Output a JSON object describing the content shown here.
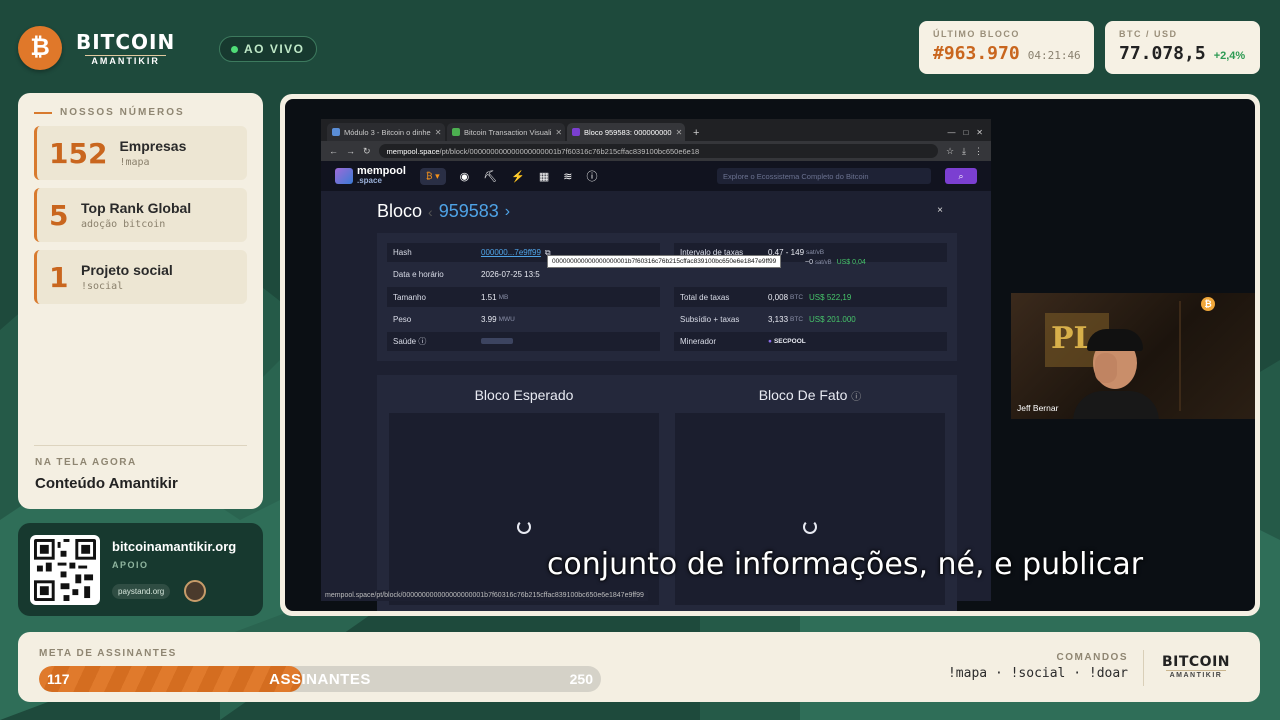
{
  "header": {
    "brand_title": "BITCOIN",
    "brand_sub": "AMANTIKIR",
    "btc_symbol": "₿",
    "live_label": "AO VIVO",
    "last_block": {
      "label": "ÚLTIMO BLOCO",
      "value": "#963.970",
      "time": "04:21:46"
    },
    "price": {
      "label": "BTC / USD",
      "value": "77.078,5",
      "change": "+2,4%"
    }
  },
  "numbers": {
    "heading": "NOSSOS NÚMEROS",
    "items": [
      {
        "value": "152",
        "title": "Empresas",
        "sub": "!mapa"
      },
      {
        "value": "5",
        "title": "Top Rank Global",
        "sub": "adoção bitcoin"
      },
      {
        "value": "1",
        "title": "Projeto social",
        "sub": "!social"
      }
    ],
    "now_label": "NA TELA AGORA",
    "now_value": "Conteúdo Amantikir"
  },
  "support": {
    "url": "bitcoinamantikir.org",
    "label": "APOIO",
    "paystand": "paystand.org"
  },
  "browser": {
    "tabs": [
      {
        "label": "Módulo 3 - Bitcoin o dinhe",
        "active": false
      },
      {
        "label": "Bitcoin Transaction Visuali",
        "active": false
      },
      {
        "label": "Bloco 959583: 000000000",
        "active": true
      }
    ],
    "new_tab": "+",
    "url_host": "mempool.space",
    "url_path": "/pt/block/000000000000000000001b7f60316c76b215cffac839100bc650e6e18",
    "mempool": {
      "logo": "mempool",
      "logo_sub": ".space",
      "btc_selector": "₿ ▾",
      "search_placeholder": "Explore o Ecossistema Completo do Bitcoin",
      "search_btn": "⌕"
    },
    "block": {
      "title": "Bloco",
      "number": "959583",
      "close": "×",
      "left": [
        {
          "k": "Hash",
          "v": "000000...7e9ff99"
        },
        {
          "k": "Data e horário",
          "v": "2026-07-25 13:5"
        },
        {
          "k": "Tamanho",
          "v": "1.51",
          "u": "MB"
        },
        {
          "k": "Peso",
          "v": "3.99",
          "u": "MWU"
        },
        {
          "k": "Saúde",
          "v": ""
        }
      ],
      "right": [
        {
          "k": "Intervalo de taxas",
          "v": "0,47 - 149",
          "u": "sat/vB"
        },
        {
          "k": "",
          "v": "",
          "u": ""
        },
        {
          "k": "Total de taxas",
          "v": "0,008",
          "u": "BTC",
          "g": "US$ 522,19"
        },
        {
          "k": "Subsídio + taxas",
          "v": "3,133",
          "u": "BTC",
          "g": "US$ 201.000"
        },
        {
          "k": "Minerador",
          "v": "SECPOOL"
        }
      ],
      "tooltip": "000000000000000000001b7f60316c76b215cffac839100bc650e6e1847e9ff99",
      "tooltip_tail": "~0",
      "tooltip_tail_unit": "sat/vB",
      "tooltip_tail_green": "US$ 0,04",
      "expected_title": "Bloco Esperado",
      "actual_title": "Bloco De Fato"
    },
    "status_url": "mempool.space/pt/block/000000000000000000001b7f60316c76b215cffac839100bc650e6e1847e9ff99"
  },
  "webcam": {
    "name": "Jeff Bernar",
    "poster": "PL"
  },
  "subtitle": "conjunto de informações, né, e publicar",
  "goal": {
    "label": "META DE ASSINANTES",
    "current": "117",
    "center": "ASSINANTES",
    "max": "250",
    "progress": 0.468
  },
  "commands": {
    "label": "COMANDOS",
    "list": "!mapa · !social · !doar"
  },
  "footer_brand": {
    "title": "BITCOIN",
    "sub": "AMANTIKIR"
  },
  "colors": {
    "accent": "#d87a2e",
    "dark_green": "#17392f",
    "cream": "#f4efe2",
    "up": "#2c9a52"
  }
}
